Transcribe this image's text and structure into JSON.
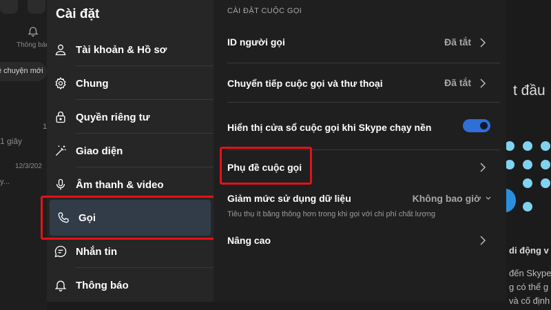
{
  "background": {
    "notification_label": "Thông báo",
    "chip_label": "ề chuyện mới",
    "time_1": "1 giây",
    "date_1": "12/3/202",
    "preview_1": "y...",
    "badge_1": "1",
    "right_heading": "t đầu",
    "right_subheading": "di động v",
    "right_line_1": "đến Skype",
    "right_line_2": "g có thể g",
    "right_line_3": "và cố định"
  },
  "nav": {
    "title": "Cài đặt",
    "items": [
      {
        "label": "Tài khoản & Hồ sơ",
        "icon": "person-icon"
      },
      {
        "label": "Chung",
        "icon": "gear-icon"
      },
      {
        "label": "Quyền riêng tư",
        "icon": "lock-icon"
      },
      {
        "label": "Giao diện",
        "icon": "magic-wand-icon"
      },
      {
        "label": "Âm thanh & video",
        "icon": "microphone-icon"
      },
      {
        "label": "Gọi",
        "icon": "phone-icon",
        "active": true
      },
      {
        "label": "Nhắn tin",
        "icon": "chat-bubble-icon"
      },
      {
        "label": "Thông báo",
        "icon": "bell-icon"
      }
    ]
  },
  "content": {
    "section_title": "CÀI ĐẶT CUỘC GỌI",
    "caller_id": {
      "label": "ID người gọi",
      "value": "Đã tắt"
    },
    "call_forwarding": {
      "label": "Chuyển tiếp cuộc gọi và thư thoại",
      "value": "Đã tắt"
    },
    "show_call_window": {
      "label": "Hiển thị cửa sổ cuộc gọi khi Skype chạy nền",
      "enabled": true
    },
    "call_subtitles": {
      "label": "Phụ đề cuộc gọi"
    },
    "reduce_data": {
      "label": "Giảm mức sử dụng dữ liệu",
      "value": "Không bao giờ",
      "description": "Tiêu thụ ít băng thông hơn trong khi gọi với chi phí chất lượng"
    },
    "advanced": {
      "label": "Nâng cao"
    }
  },
  "colors": {
    "accent": "#2e6fd8",
    "highlight": "#e3121b",
    "active_nav": "#323c48"
  }
}
